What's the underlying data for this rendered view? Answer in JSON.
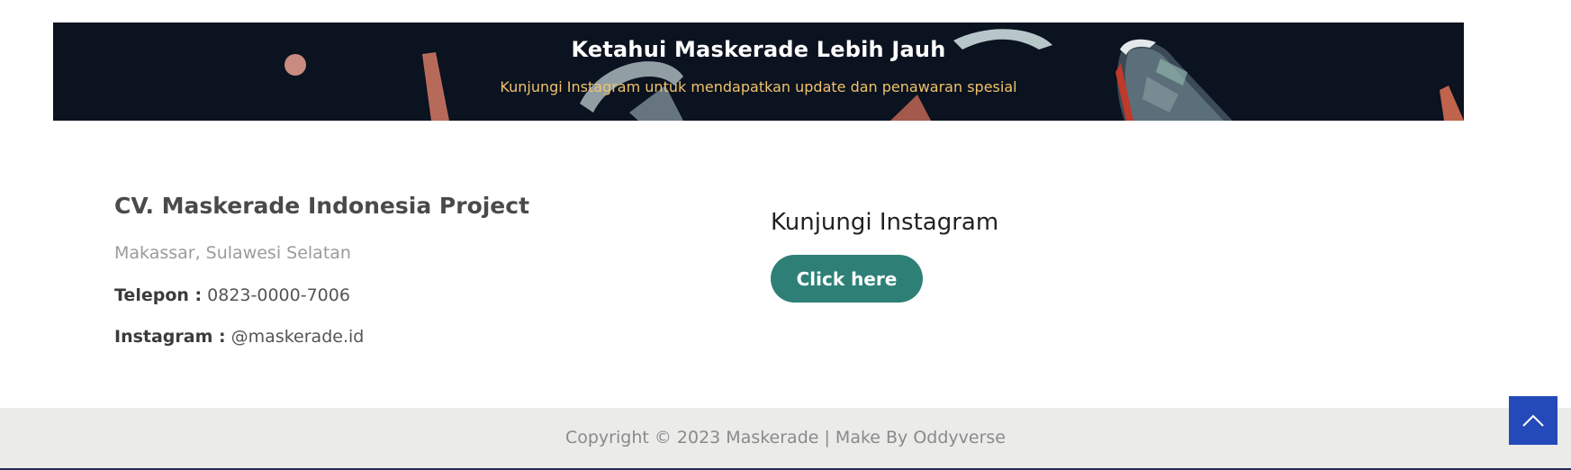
{
  "banner": {
    "title": "Ketahui Maskerade Lebih Jauh",
    "subtitle": "Kunjungi Instagram untuk mendapatkan update dan penawaran spesial",
    "background_color": "#0b1220",
    "subtitle_color": "#f0c26a"
  },
  "company": {
    "name": "CV. Maskerade Indonesia Project",
    "address": "Makassar, Sulawesi Selatan",
    "phone_label": "Telepon :",
    "phone_value": "0823-0000-7006",
    "instagram_label": "Instagram :",
    "instagram_value": "@maskerade.id"
  },
  "instagram_cta": {
    "title": "Kunjungi Instagram",
    "button_label": "Click here",
    "button_color": "#2e8077"
  },
  "footer": {
    "copyright": "Copyright © 2023 Maskerade | Make By Oddyverse",
    "background_color": "#ebebea"
  },
  "back_to_top": {
    "icon": "chevron-up-icon",
    "color": "#2449b8"
  }
}
